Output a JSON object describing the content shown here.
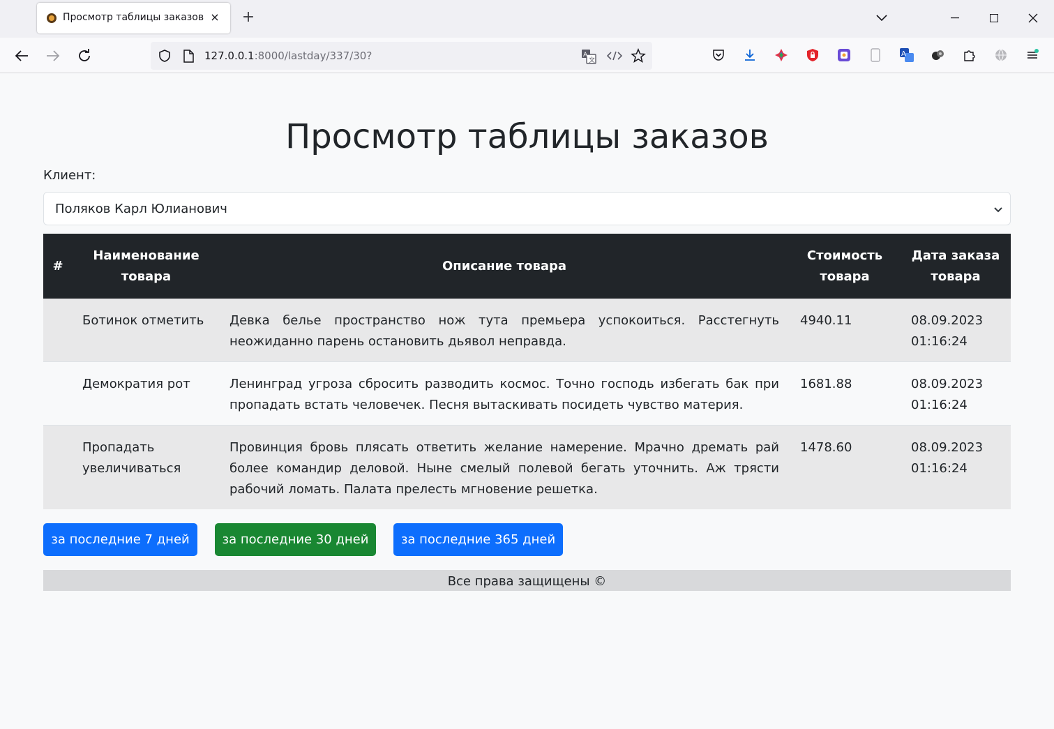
{
  "browser": {
    "tab_title": "Просмотр таблицы заказов",
    "tab_close_icon": "×",
    "new_tab_icon": "+",
    "url_host": "127.0.0.1",
    "url_rest": ":8000/lastday/337/30?"
  },
  "page": {
    "title": "Просмотр таблицы заказов",
    "client_label": "Клиент:",
    "client_selected": "Поляков Карл Юлианович"
  },
  "table": {
    "headers": {
      "num": "#",
      "name": "Наименование товара",
      "description": "Описание товара",
      "price": "Стоимость товара",
      "date": "Дата заказа товара"
    },
    "rows": [
      {
        "name": "Ботинок отметить",
        "description": "Девка белье пространство нож тута премьера успокоиться. Расстегнуть неожиданно парень остановить дьявол неправда.",
        "price": "4940.11",
        "date": "08.09.2023 01:16:24"
      },
      {
        "name": "Демократия рот",
        "description": "Ленинград угроза сбросить разводить космос. Точно господь избегать бак при пропадать встать человечек. Песня вытаскивать посидеть чувство материя.",
        "price": "1681.88",
        "date": "08.09.2023 01:16:24"
      },
      {
        "name": "Пропадать увеличиваться",
        "description": "Провинция бровь плясать ответить желание намерение. Мрачно дремать рай более командир деловой. Ныне смелый полевой бегать уточнить. Аж трясти рабочий ломать. Палата прелесть мгновение решетка.",
        "price": "1478.60",
        "date": "08.09.2023 01:16:24"
      }
    ]
  },
  "buttons": {
    "days7": "за последние 7 дней",
    "days30": "за последние 30 дней",
    "days365": "за последние 365 дней"
  },
  "footer": {
    "text": "Все права защищены ©"
  },
  "colors": {
    "primary": "#0d6efd",
    "success": "#198754",
    "dark": "#212529"
  }
}
